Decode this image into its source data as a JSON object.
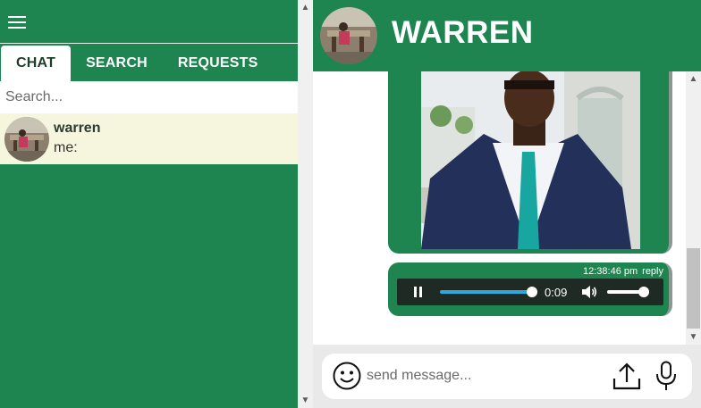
{
  "sidebar": {
    "tabs": [
      {
        "label": "CHAT",
        "active": true
      },
      {
        "label": "SEARCH",
        "active": false
      },
      {
        "label": "REQUESTS",
        "active": false
      }
    ],
    "search": {
      "placeholder": "Search..."
    },
    "contacts": [
      {
        "name": "warren",
        "last_message": "me:"
      }
    ]
  },
  "chat": {
    "title": "WARREN",
    "messages": [
      {
        "type": "image"
      },
      {
        "type": "audio",
        "timestamp": "12:38:46 pm",
        "reply_label": "reply",
        "elapsed": "0:09",
        "progress": 1.0,
        "volume": 0.85
      }
    ],
    "input": {
      "placeholder": "send message..."
    }
  },
  "colors": {
    "primary": "#1e8450",
    "contact_bg": "#f6f5dd",
    "seek": "#2ea8df"
  },
  "icons": [
    "menu-icon",
    "smiley-icon",
    "upload-icon",
    "microphone-icon",
    "pause-icon",
    "volume-icon"
  ]
}
